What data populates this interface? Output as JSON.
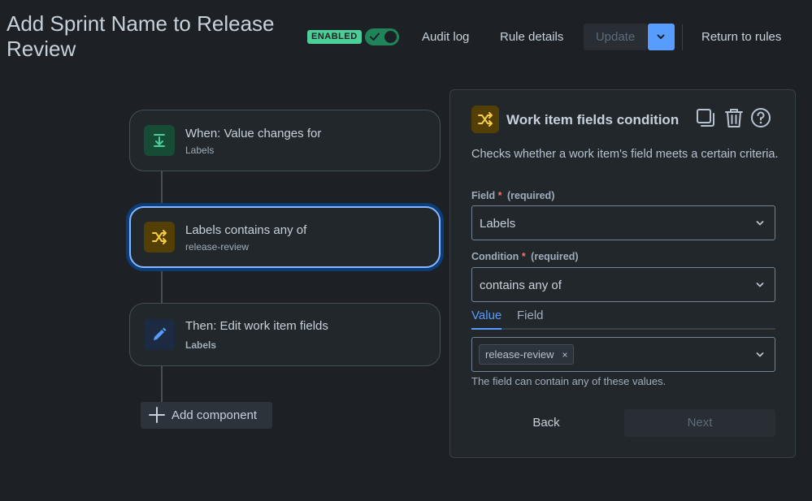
{
  "rule": {
    "title": "Add Sprint Name to Release Review",
    "status_badge": "ENABLED",
    "toggle_enabled": true
  },
  "header": {
    "audit_log": "Audit log",
    "rule_details": "Rule details",
    "update": "Update",
    "return_to_rules": "Return to rules"
  },
  "flow": {
    "components": [
      {
        "title": "When: Value changes for",
        "subtitle": "Labels",
        "icon": "download-arrow-icon",
        "color": "#4bce97"
      },
      {
        "title": "Labels contains any of",
        "subtitle": "release-review",
        "icon": "shuffle-icon",
        "color": "#f5cd47"
      },
      {
        "title": "Then: Edit work item fields",
        "subtitle": "Labels",
        "icon": "pencil-icon",
        "color": "#579dff"
      }
    ],
    "add_component": "Add component"
  },
  "panel": {
    "title": "Work item fields condition",
    "description": "Checks whether a work item's field meets a certain criteria.",
    "field_label": "Field",
    "condition_label": "Condition",
    "required_mark": "*",
    "required_text": "(required)",
    "field_value": "Labels",
    "condition_value": "contains any of",
    "tabs": [
      "Value",
      "Field"
    ],
    "selected_values": [
      "release-review"
    ],
    "chip_remove": "×",
    "helper": "The field can contain any of these values.",
    "back": "Back",
    "next": "Next"
  }
}
